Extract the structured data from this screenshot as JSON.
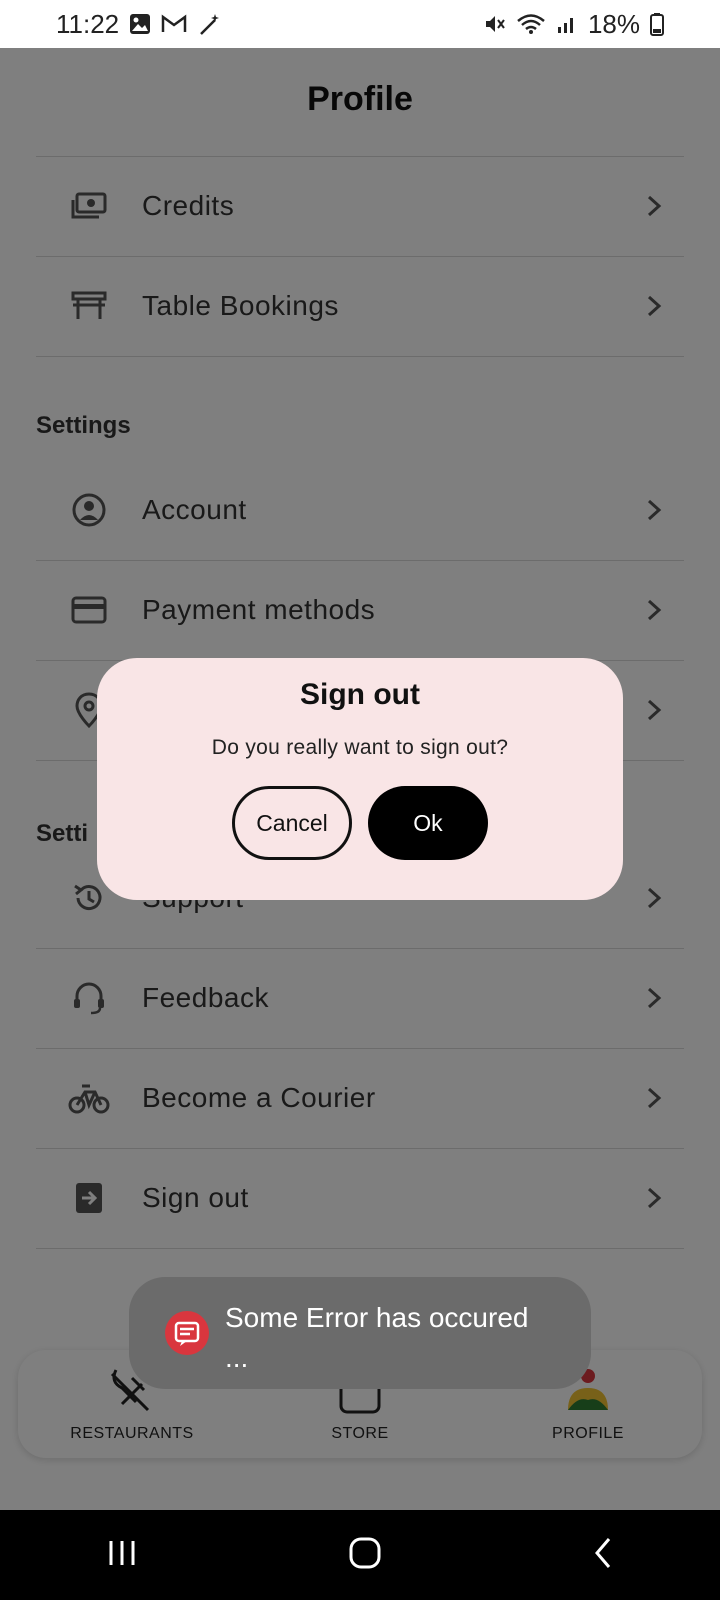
{
  "status_bar": {
    "time": "11:22",
    "battery": "18%"
  },
  "header": {
    "title": "Profile"
  },
  "menu_top": [
    {
      "label": "Credits",
      "icon": "wallet-icon"
    },
    {
      "label": "Table Bookings",
      "icon": "table-icon"
    }
  ],
  "settings_section": {
    "title": "Settings",
    "items": [
      {
        "label": "Account",
        "icon": "account-icon"
      },
      {
        "label": "Payment methods",
        "icon": "card-icon"
      }
    ]
  },
  "second_section": {
    "title": "Setti"
  },
  "support_items": [
    {
      "label": "Support",
      "icon": "history-icon"
    },
    {
      "label": "Feedback",
      "icon": "feedback-icon"
    },
    {
      "label": "Become a Courier",
      "icon": "bike-icon"
    },
    {
      "label": "Sign out",
      "icon": "signout-icon"
    }
  ],
  "bottom_nav": [
    {
      "label": "RESTAURANTS",
      "icon": "restaurant-icon"
    },
    {
      "label": "STORE",
      "icon": "bag-icon"
    },
    {
      "label": "PROFILE",
      "icon": "profile-icon"
    }
  ],
  "dialog": {
    "title": "Sign out",
    "message": "Do you really want to sign out?",
    "cancel_label": "Cancel",
    "ok_label": "Ok"
  },
  "toast": {
    "line1": "Some Error has occured",
    "line2": "..."
  },
  "colors": {
    "dialog_bg": "#f9e5e6",
    "toast_bg": "#6b6b6b",
    "toast_icon": "#d9363e"
  }
}
